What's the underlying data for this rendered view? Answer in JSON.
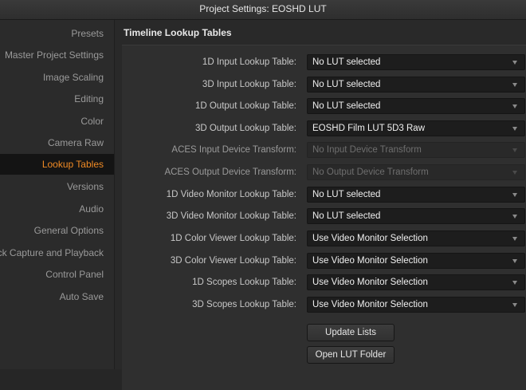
{
  "window": {
    "title": "Project Settings:  EOSHD LUT"
  },
  "sidebar": {
    "items": [
      {
        "label": "Presets",
        "active": false
      },
      {
        "label": "Master Project Settings",
        "active": false
      },
      {
        "label": "Image Scaling",
        "active": false
      },
      {
        "label": "Editing",
        "active": false
      },
      {
        "label": "Color",
        "active": false
      },
      {
        "label": "Camera Raw",
        "active": false
      },
      {
        "label": "Lookup Tables",
        "active": true
      },
      {
        "label": "Versions",
        "active": false
      },
      {
        "label": "Audio",
        "active": false
      },
      {
        "label": "General Options",
        "active": false
      },
      {
        "label": "ck Capture and Playback",
        "active": false
      },
      {
        "label": "Control Panel",
        "active": false
      },
      {
        "label": "Auto Save",
        "active": false
      }
    ]
  },
  "main": {
    "section_title": "Timeline Lookup Tables",
    "rows": [
      {
        "label": "1D Input Lookup Table:",
        "value": "No LUT selected",
        "disabled": false
      },
      {
        "label": "3D Input Lookup Table:",
        "value": "No LUT selected",
        "disabled": false
      },
      {
        "label": "1D Output Lookup Table:",
        "value": "No LUT selected",
        "disabled": false
      },
      {
        "label": "3D Output Lookup Table:",
        "value": "EOSHD Film LUT 5D3 Raw",
        "disabled": false
      },
      {
        "label": "ACES Input Device Transform:",
        "value": "No Input Device Transform",
        "disabled": true
      },
      {
        "label": "ACES Output Device Transform:",
        "value": "No Output Device Transform",
        "disabled": true
      },
      {
        "label": "1D Video Monitor Lookup Table:",
        "value": "No LUT selected",
        "disabled": false
      },
      {
        "label": "3D Video Monitor Lookup Table:",
        "value": "No LUT selected",
        "disabled": false
      },
      {
        "label": "1D Color Viewer Lookup Table:",
        "value": "Use Video Monitor Selection",
        "disabled": false
      },
      {
        "label": "3D Color Viewer Lookup Table:",
        "value": "Use Video Monitor Selection",
        "disabled": false
      },
      {
        "label": "1D Scopes Lookup Table:",
        "value": "Use Video Monitor Selection",
        "disabled": false
      },
      {
        "label": "3D Scopes Lookup Table:",
        "value": "Use Video Monitor Selection",
        "disabled": false
      }
    ],
    "buttons": {
      "update_lists": "Update Lists",
      "open_lut_folder": "Open LUT Folder"
    }
  },
  "colors": {
    "accent": "#f08a24",
    "background": "#262626"
  }
}
